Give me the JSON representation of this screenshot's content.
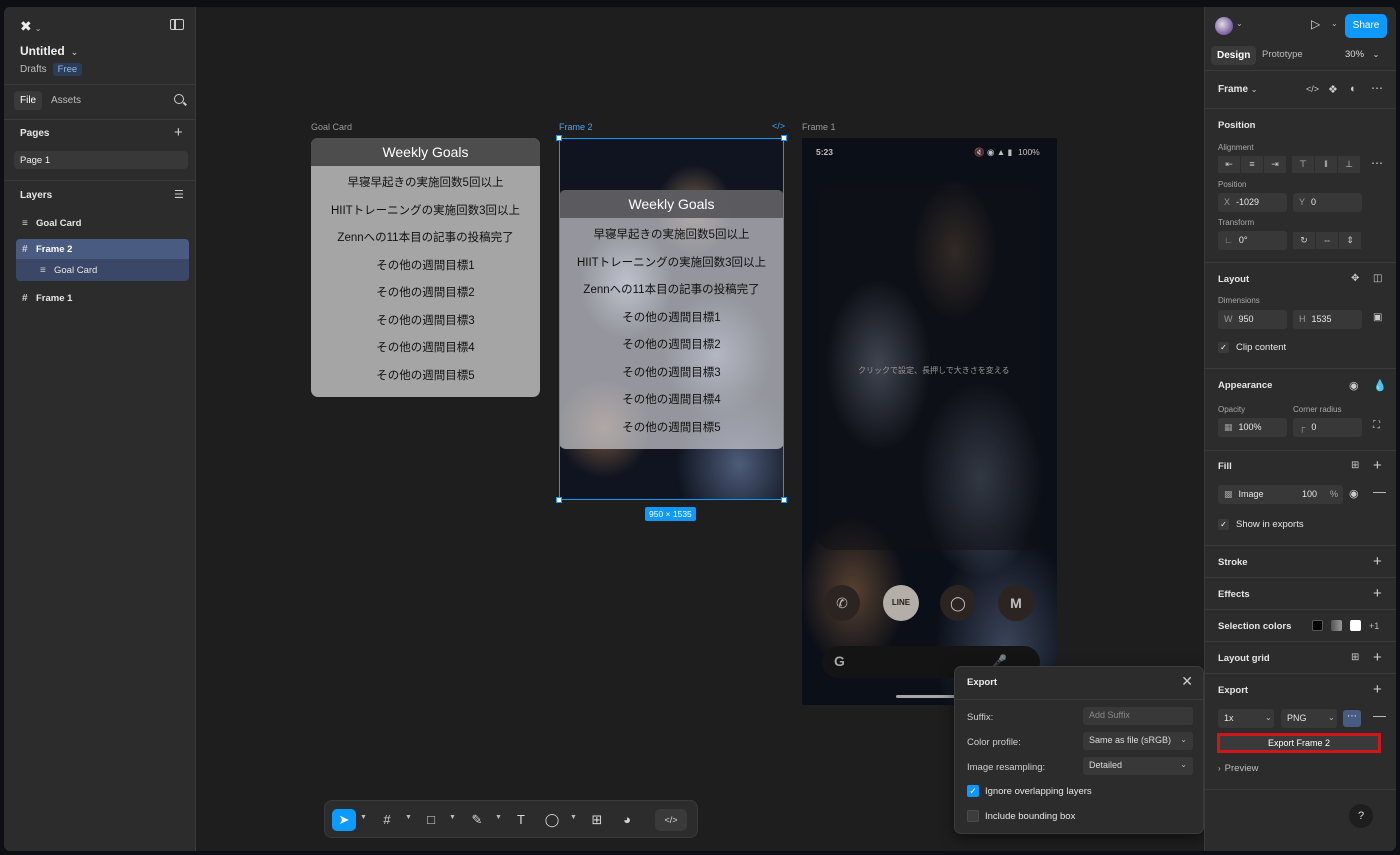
{
  "left_panel": {
    "file_title": "Untitled",
    "drafts": "Drafts",
    "plan_badge": "Free",
    "tabs": {
      "file": "File",
      "assets": "Assets"
    },
    "pages_label": "Pages",
    "pages": [
      {
        "label": "Page 1"
      }
    ],
    "layers_label": "Layers",
    "layers": [
      {
        "label": "Goal Card"
      },
      {
        "label": "Frame 2"
      },
      {
        "label": "Goal Card"
      },
      {
        "label": "Frame 1"
      }
    ]
  },
  "canvas": {
    "goal_card_label": "Goal Card",
    "frame2_label": "Frame 2",
    "frame1_label": "Frame 1",
    "goal_card": {
      "title": "Weekly Goals",
      "items": [
        "早寝早起きの実施回数5回以上",
        "HIITトレーニングの実施回数3回以上",
        "Zennへの11本目の記事の投稿完了",
        "その他の週間目標1",
        "その他の週間目標2",
        "その他の週間目標3",
        "その他の週間目標4",
        "その他の週間目標5"
      ]
    },
    "dimension_badge": "950 × 1535",
    "phone": {
      "time": "5:23",
      "battery": "100%",
      "widget_hint": "クリックで設定、長押しで大きさを変える"
    }
  },
  "export_popover": {
    "title": "Export",
    "suffix_label": "Suffix:",
    "suffix_placeholder": "Add Suffix",
    "color_profile_label": "Color profile:",
    "color_profile_value": "Same as file (sRGB)",
    "resampling_label": "Image resampling:",
    "resampling_value": "Detailed",
    "ignore_overlap_label": "Ignore overlapping layers",
    "ignore_overlap_checked": true,
    "include_bbox_label": "Include bounding box",
    "include_bbox_checked": false
  },
  "right_panel": {
    "share": "Share",
    "tabs": {
      "design": "Design",
      "prototype": "Prototype"
    },
    "zoom": "30%",
    "selection_type": "Frame",
    "position_label": "Position",
    "alignment_label": "Alignment",
    "position_sub": "Position",
    "x_label": "X",
    "x_value": "-1029",
    "y_label": "Y",
    "y_value": "0",
    "transform_label": "Transform",
    "rotation": "0°",
    "layout_label": "Layout",
    "dimensions_label": "Dimensions",
    "w_label": "W",
    "w_value": "950",
    "h_label": "H",
    "h_value": "1535",
    "clip_content": "Clip content",
    "appearance_label": "Appearance",
    "opacity_label": "Opacity",
    "opacity_value": "100%",
    "corner_radius_label": "Corner radius",
    "corner_radius_value": "0",
    "fill_label": "Fill",
    "fill_type": "Image",
    "fill_opacity": "100",
    "fill_pct": "%",
    "show_in_exports": "Show in exports",
    "stroke_label": "Stroke",
    "effects_label": "Effects",
    "selection_colors_label": "Selection colors",
    "selection_colors_more": "+1",
    "layout_grid_label": "Layout grid",
    "export_label": "Export",
    "export_scale": "1x",
    "export_format": "PNG",
    "export_button": "Export Frame 2",
    "preview_label": "Preview",
    "help": "?"
  },
  "colors": {
    "accent": "#0d99ff",
    "highlight_box": "#d0161b",
    "selected_layer": "#4a5b82"
  }
}
